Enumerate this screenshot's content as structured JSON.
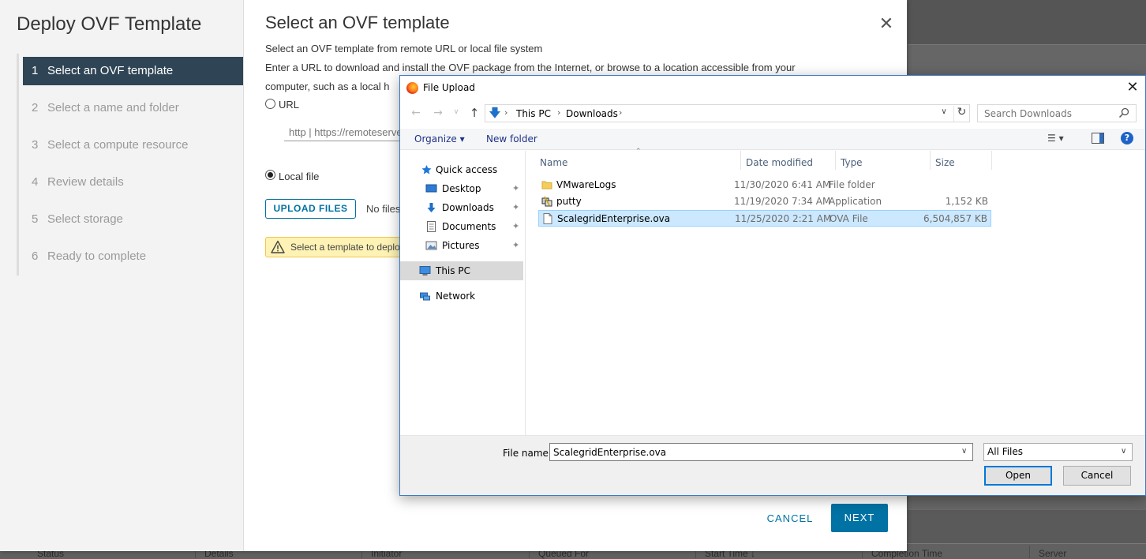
{
  "background": {
    "table_columns": [
      "Status",
      "Details",
      "Initiator",
      "Queued For",
      "Start Time",
      "Completion Time",
      "Server"
    ],
    "start_time_sort_glyph": "↓"
  },
  "wizard": {
    "title": "Deploy OVF Template",
    "steps": [
      {
        "num": "1",
        "label": "Select an OVF template"
      },
      {
        "num": "2",
        "label": "Select a name and folder"
      },
      {
        "num": "3",
        "label": "Select a compute resource"
      },
      {
        "num": "4",
        "label": "Review details"
      },
      {
        "num": "5",
        "label": "Select storage"
      },
      {
        "num": "6",
        "label": "Ready to complete"
      }
    ],
    "active_step": 1,
    "main_title": "Select an OVF template",
    "close_glyph": "✕",
    "intro": "Select an OVF template from remote URL or local file system",
    "desc_line1": "Enter a URL to download and install the OVF package from the Internet, or browse to a location accessible from your",
    "desc_line2": "computer, such as a local h",
    "url_radio_label": "URL",
    "url_placeholder": "http | https://remoteserver-address/filetodeploy.ovf | .ova",
    "local_radio_label": "Local file",
    "upload_label": "UPLOAD FILES",
    "no_files_text": "No files",
    "warning_text": "Select a template to deploy.",
    "cancel_label": "CANCEL",
    "next_label": "NEXT"
  },
  "file_dialog": {
    "title": "File Upload",
    "close_glyph": "✕",
    "breadcrumb": [
      "This PC",
      "Downloads"
    ],
    "search_placeholder": "Search Downloads",
    "organize_label": "Organize ▾",
    "new_folder_label": "New folder",
    "help_glyph": "?",
    "nav": [
      {
        "label": "Quick access",
        "icon": "star-icon",
        "pinned": false
      },
      {
        "label": "Desktop",
        "icon": "desktop-icon",
        "pinned": true
      },
      {
        "label": "Downloads",
        "icon": "download-icon",
        "pinned": true
      },
      {
        "label": "Documents",
        "icon": "document-icon",
        "pinned": true
      },
      {
        "label": "Pictures",
        "icon": "picture-icon",
        "pinned": true
      },
      {
        "label": "This PC",
        "icon": "computer-icon",
        "pinned": false
      },
      {
        "label": "Network",
        "icon": "network-icon",
        "pinned": false
      }
    ],
    "pin_glyph": "📌",
    "columns": [
      "Name",
      "Date modified",
      "Type",
      "Size"
    ],
    "files": [
      {
        "name": "VMwareLogs",
        "date": "11/30/2020 6:41 AM",
        "type": "File folder",
        "size": "",
        "icon": "folder-icon"
      },
      {
        "name": "putty",
        "date": "11/19/2020 7:34 AM",
        "type": "Application",
        "size": "1,152 KB",
        "icon": "putty-icon"
      },
      {
        "name": "ScalegridEnterprise.ova",
        "date": "11/25/2020 2:21 AM",
        "type": "OVA File",
        "size": "6,504,857 KB",
        "icon": "file-icon"
      }
    ],
    "selected_file": "ScalegridEnterprise.ova",
    "filename_label": "File name:",
    "filename_value": "ScalegridEnterprise.ova",
    "filetype_value": "All Files",
    "open_label": "Open",
    "cancel_label": "Cancel"
  },
  "colors": {
    "wizard_active_step": "#2f4556",
    "primary_blue": "#0072a3",
    "warning_bg": "#fef3b5",
    "selection_bg": "#cce8ff"
  }
}
